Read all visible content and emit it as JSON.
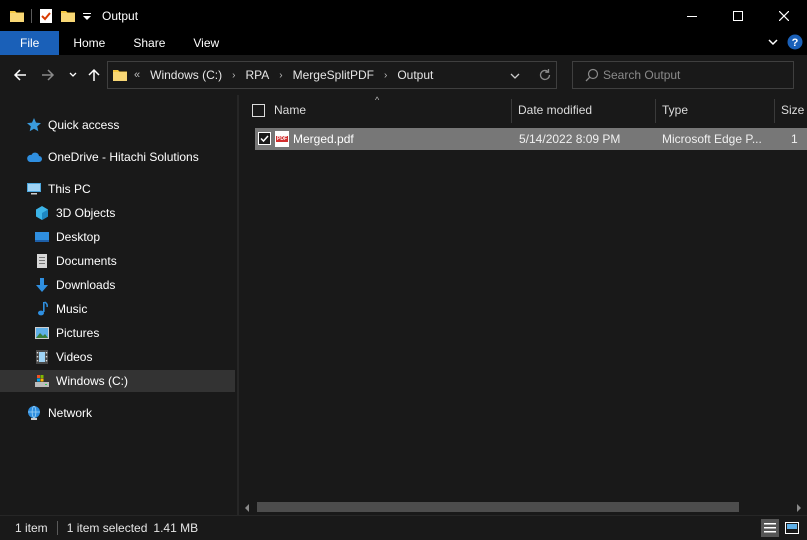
{
  "window": {
    "title": "Output",
    "controls": {
      "minimize": "minimize-icon",
      "maximize": "maximize-icon",
      "close": "close-icon"
    }
  },
  "ribbon": {
    "tabs": [
      {
        "label": "File",
        "active": true
      },
      {
        "label": "Home"
      },
      {
        "label": "Share"
      },
      {
        "label": "View"
      }
    ]
  },
  "address": {
    "overflow": "«",
    "crumbs": [
      "Windows (C:)",
      "RPA",
      "MergeSplitPDF",
      "Output"
    ]
  },
  "search": {
    "placeholder": "Search Output"
  },
  "nav": {
    "items": [
      {
        "label": "Quick access",
        "icon": "star-icon"
      },
      {
        "label": "OneDrive - Hitachi Solutions",
        "icon": "cloud-icon"
      },
      {
        "label": "This PC",
        "icon": "computer-icon"
      },
      {
        "label": "3D Objects",
        "icon": "cube-icon"
      },
      {
        "label": "Desktop",
        "icon": "desktop-icon"
      },
      {
        "label": "Documents",
        "icon": "document-icon"
      },
      {
        "label": "Downloads",
        "icon": "download-arrow-icon"
      },
      {
        "label": "Music",
        "icon": "music-note-icon"
      },
      {
        "label": "Pictures",
        "icon": "picture-icon"
      },
      {
        "label": "Videos",
        "icon": "film-icon"
      },
      {
        "label": "Windows (C:)",
        "icon": "drive-icon",
        "selected": true
      },
      {
        "label": "Network",
        "icon": "network-icon"
      }
    ]
  },
  "columns": {
    "name": "Name",
    "date": "Date modified",
    "type": "Type",
    "size": "Size"
  },
  "files": [
    {
      "name": "Merged.pdf",
      "date": "5/14/2022 8:09 PM",
      "type": "Microsoft Edge P...",
      "size": "1"
    }
  ],
  "pdf_badge": "PDF",
  "status": {
    "count": "1 item",
    "selected": "1 item selected",
    "size": "1.41 MB"
  },
  "colors": {
    "accent": "#1a60b8",
    "folder": "#f5c842",
    "selection": "#777777"
  }
}
